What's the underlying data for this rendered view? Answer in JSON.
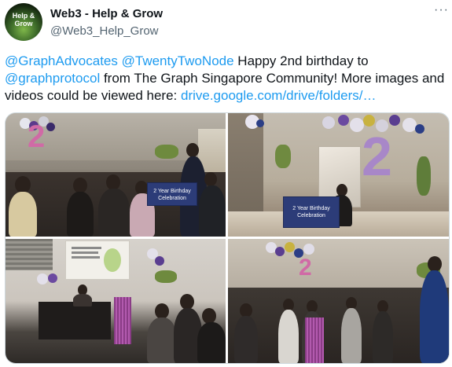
{
  "tweet": {
    "author": {
      "display_name": "Web3 - Help & Grow",
      "handle": "@Web3_Help_Grow",
      "avatar_text": "Help & Grow"
    },
    "more_menu": "···",
    "text": {
      "mention1": "@GraphAdvocates",
      "mention2": "@TwentyTwoNode",
      "segment1": " Happy 2nd birthday to ",
      "mention3": "@graphprotocol",
      "segment2": " from The Graph Singapore Community! More images and videos could be viewed here: ",
      "link": "drive.google.com/drive/folders/…"
    },
    "media": {
      "banner1": "2 Year Birthday Celebration",
      "banner2": "2 Year Birthday Celebration",
      "balloon_digit": "2"
    }
  },
  "colors": {
    "link": "#1d9bf0",
    "handle": "#536471",
    "text": "#0f1419",
    "banner": "#2c3c78"
  }
}
